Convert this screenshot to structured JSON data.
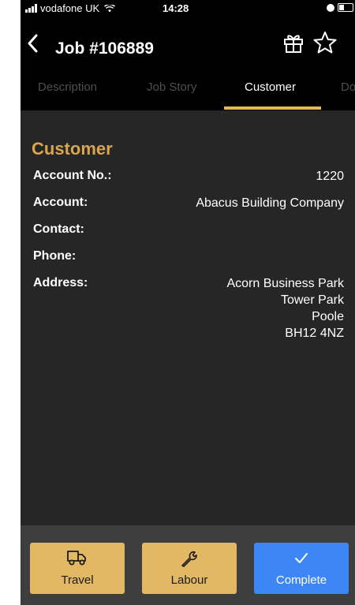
{
  "status_bar": {
    "carrier": "vodafone UK",
    "time": "14:28"
  },
  "nav": {
    "title": "Job #106889"
  },
  "tabs": [
    {
      "label": "Description"
    },
    {
      "label": "Job Story"
    },
    {
      "label": "Customer"
    },
    {
      "label": "Do"
    }
  ],
  "customer": {
    "section_title": "Customer",
    "fields": [
      {
        "label": "Account No.:",
        "value": "1220"
      },
      {
        "label": "Account:",
        "value": "Abacus Building Company"
      },
      {
        "label": "Contact:",
        "value": ""
      },
      {
        "label": "Phone:",
        "value": ""
      },
      {
        "label": "Address:",
        "value": ""
      }
    ],
    "address_lines": [
      "Acorn Business Park",
      "Tower Park",
      "Poole",
      "BH12 4NZ"
    ]
  },
  "actions": {
    "travel": "Travel",
    "labour": "Labour",
    "complete": "Complete"
  },
  "colors": {
    "accent": "#e8b856",
    "section_title": "#dba54e",
    "button_gold": "#e2b865",
    "button_blue": "#3d86f5",
    "background": "#262626"
  }
}
